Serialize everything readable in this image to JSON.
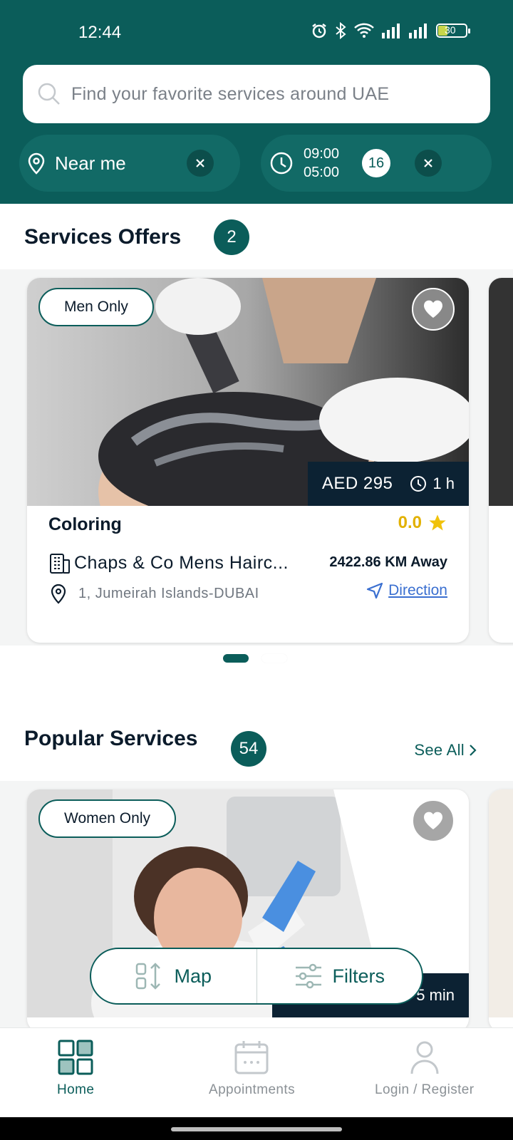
{
  "status_bar": {
    "time": "12:44",
    "battery": "30"
  },
  "search": {
    "placeholder": "Find your favorite services around UAE"
  },
  "filters": {
    "location_label": "Near me",
    "time_start": "09:00",
    "time_end": "05:00",
    "time_badge": "16"
  },
  "offers": {
    "title": "Services Offers",
    "count": "2",
    "card": {
      "tag": "Men Only",
      "price": "AED 295",
      "duration": "1 h",
      "name": "Coloring",
      "rating": "0.0",
      "salon": "Chaps & Co Mens Hairc...",
      "distance": "2422.86 KM Away",
      "address": "1, Jumeirah Islands-DUBAI",
      "direction_label": "Direction"
    },
    "pager": {
      "pages": 2,
      "active": 1
    }
  },
  "popular": {
    "title": "Popular Services",
    "count": "54",
    "see_all": "See All",
    "card": {
      "tag": "Women Only",
      "duration_partial": "5 min"
    }
  },
  "floating": {
    "map_label": "Map",
    "filters_label": "Filters"
  },
  "bottom_nav": {
    "items": [
      {
        "label": "Home",
        "icon": "grid-icon",
        "active": true
      },
      {
        "label": "Appointments",
        "icon": "calendar-icon",
        "active": false
      },
      {
        "label": "Login / Register",
        "icon": "user-icon",
        "active": false
      }
    ]
  },
  "colors": {
    "brand": "#0b5d5a",
    "accent_gold": "#e2b100",
    "link": "#3a6fd0",
    "dark": "#0c2233"
  }
}
